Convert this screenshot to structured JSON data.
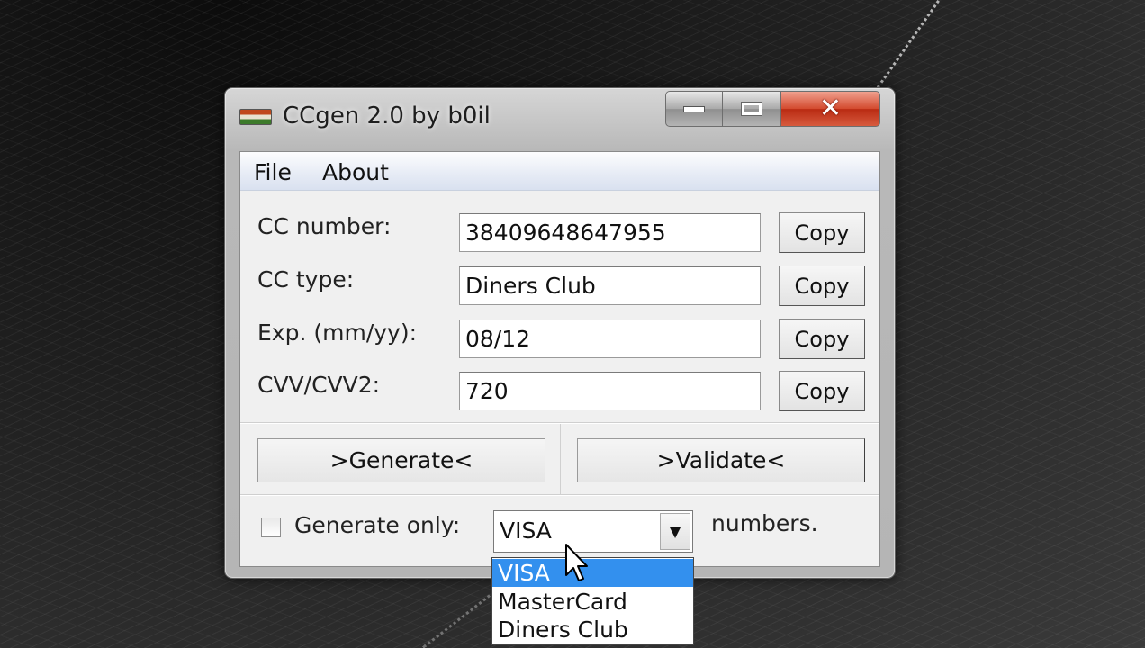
{
  "window": {
    "title": "CCgen 2.0 by b0il"
  },
  "menu": {
    "items": [
      "File",
      "About"
    ]
  },
  "fields": [
    {
      "label": "CC number:",
      "value": "38409648647955",
      "copy_label": "Copy"
    },
    {
      "label": "CC type:",
      "value": "Diners Club",
      "copy_label": "Copy"
    },
    {
      "label": "Exp. (mm/yy):",
      "value": "08/12",
      "copy_label": "Copy"
    },
    {
      "label": "CVV/CVV2:",
      "value": "720",
      "copy_label": "Copy"
    }
  ],
  "actions": {
    "generate_label": ">Generate<",
    "validate_label": ">Validate<"
  },
  "filter": {
    "checkbox_checked": false,
    "checkbox_label": "Generate only:",
    "selected": "VISA",
    "suffix_label": "numbers.",
    "options": [
      "VISA",
      "MasterCard",
      "Diners Club"
    ],
    "highlighted_option": "VISA"
  },
  "icons": {
    "app": "app-flag-icon",
    "minimize": "minimize-icon",
    "maximize": "maximize-icon",
    "close": "close-icon",
    "dropdown": "chevron-down-icon",
    "cursor": "mouse-pointer-icon"
  },
  "colors": {
    "selection": "#3390ee",
    "close_button": "#c8371c",
    "menubar": "#e6ebf5"
  }
}
